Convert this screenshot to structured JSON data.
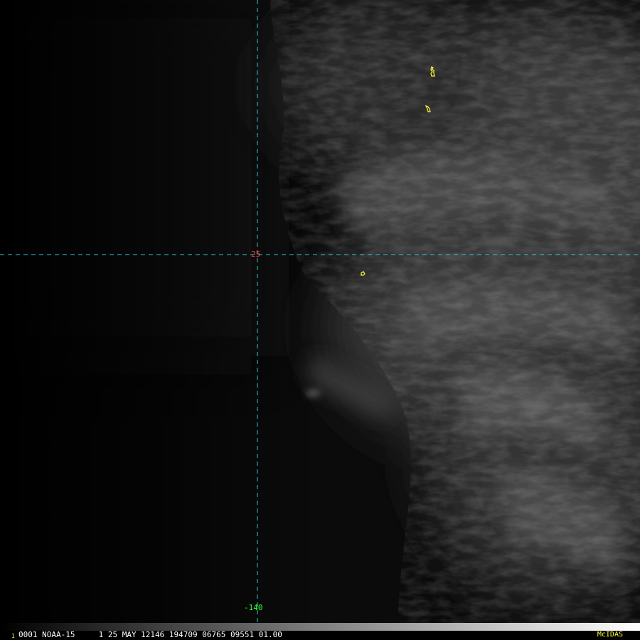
{
  "image": {
    "description_colors": {
      "background": "#050505",
      "cloud": "#a0a0a0",
      "grid": "#33c9c9",
      "coastline": "#ffff33",
      "lat_label": "#ff3333",
      "lon_label": "#33ff33",
      "header_text": "#ffffff",
      "brand_text": "#ffff33",
      "frame_number": "#ffff33"
    }
  },
  "grid": {
    "latitude_label": "25",
    "longitude_label": "-140"
  },
  "status_bar": {
    "frame_number": "1",
    "header": "0001 NOAA-15     1 25 MAY 12146 194709 06765 09551 01.00",
    "brand": "McIDAS"
  }
}
